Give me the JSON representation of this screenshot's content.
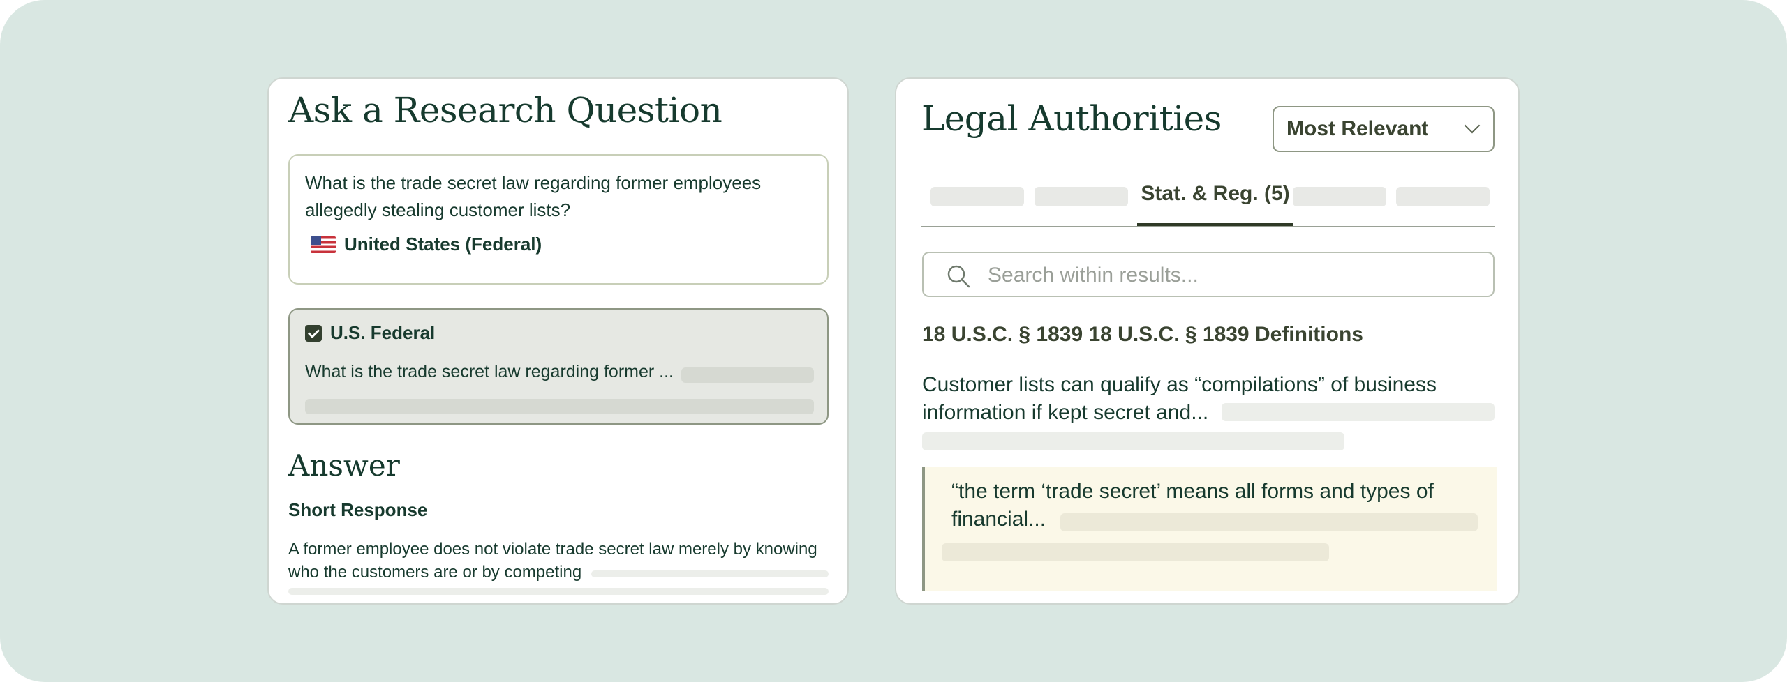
{
  "research": {
    "title": "Ask a Research Question",
    "question": "What is the trade secret law regarding former employees allegedly stealing customer lists?",
    "jurisdiction": "United States (Federal)",
    "result": {
      "title": "U.S. Federal",
      "snippet": "What is the trade secret law regarding former ...",
      "checked": true
    },
    "answer": {
      "title": "Answer",
      "subtitle": "Short Response",
      "text": "A former employee does not violate trade secret law merely by knowing who the customers are or by competing"
    }
  },
  "authorities": {
    "title": "Legal Authorities",
    "sort": "Most Relevant",
    "active_tab": "Stat. & Reg. (5)",
    "search_placeholder": "Search within results...",
    "citation": "18 U.S.C. § 1839 18 U.S.C. § 1839 Definitions",
    "summary": "Customer lists can qualify as “compilations” of business information if kept secret and...",
    "quote": "“the term ‘trade secret’ means all forms and types of financial..."
  },
  "colors": {
    "background": "#d9e7e2",
    "accent": "#2f3a27",
    "text": "#173a2e",
    "quote_bg": "#fbf8e8"
  },
  "icons": {
    "flag": "us-flag-icon",
    "checkbox": "checkbox-checked-icon",
    "chevron": "chevron-down-icon",
    "search": "search-icon"
  }
}
